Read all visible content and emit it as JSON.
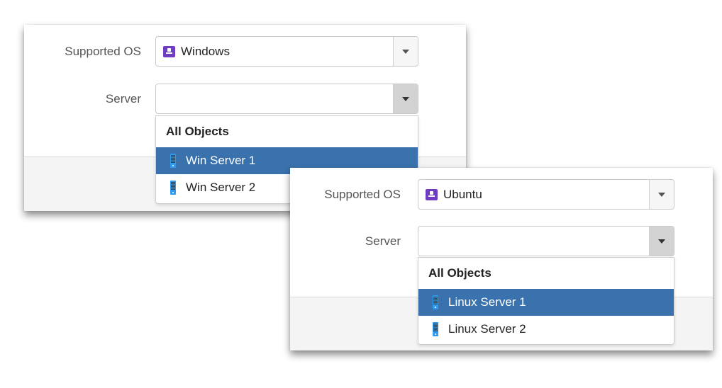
{
  "panels": [
    {
      "os_label": "Supported OS",
      "os_value": "Windows",
      "os_icon": "os-icon",
      "server_label": "Server",
      "server_value": "",
      "dropdown": {
        "header": "All Objects",
        "items": [
          {
            "label": "Win Server 1",
            "icon": "server-icon",
            "active": true
          },
          {
            "label": "Win Server 2",
            "icon": "server-icon",
            "active": false
          }
        ]
      }
    },
    {
      "os_label": "Supported OS",
      "os_value": "Ubuntu",
      "os_icon": "os-icon",
      "server_label": "Server",
      "server_value": "",
      "dropdown": {
        "header": "All Objects",
        "items": [
          {
            "label": "Linux Server 1",
            "icon": "server-icon",
            "active": true
          },
          {
            "label": "Linux Server 2",
            "icon": "server-icon",
            "active": false
          }
        ]
      }
    }
  ],
  "colors": {
    "highlight": "#3a72ad",
    "os_icon": "#6f3cc4",
    "server_icon": "#2f9bf0"
  }
}
